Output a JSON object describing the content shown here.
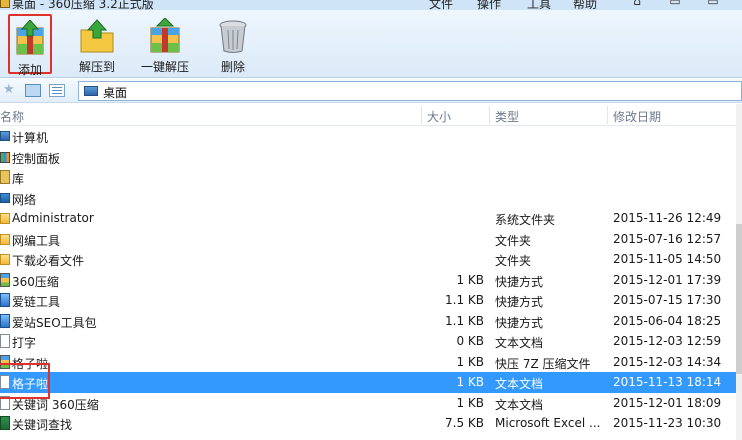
{
  "window": {
    "title": "桌面 - 360压缩 3.2正式版",
    "menus": [
      "文件",
      "操作",
      "工具",
      "帮助"
    ]
  },
  "toolbar": {
    "add_label": "添加",
    "extract_to_label": "解压到",
    "one_click_extract_label": "一键解压",
    "delete_label": "删除"
  },
  "address": {
    "path": "桌面"
  },
  "columns": {
    "name": "名称",
    "size": "大小",
    "type": "类型",
    "modified": "修改日期"
  },
  "files": [
    {
      "name": "计算机",
      "size": "",
      "type": "",
      "date": "",
      "icon": "computer-icon"
    },
    {
      "name": "控制面板",
      "size": "",
      "type": "",
      "date": "",
      "icon": "control-panel-icon"
    },
    {
      "name": "库",
      "size": "",
      "type": "",
      "date": "",
      "icon": "library-icon"
    },
    {
      "name": "网络",
      "size": "",
      "type": "",
      "date": "",
      "icon": "network-icon"
    },
    {
      "name": "Administrator",
      "size": "",
      "type": "系统文件夹",
      "date": "2015-11-26 12:49",
      "icon": "folder-icon"
    },
    {
      "name": "网编工具",
      "size": "",
      "type": "文件夹",
      "date": "2015-07-16 12:57",
      "icon": "folder-icon"
    },
    {
      "name": "下载必看文件",
      "size": "",
      "type": "文件夹",
      "date": "2015-11-05 14:50",
      "icon": "folder-icon"
    },
    {
      "name": "360压缩",
      "size": "1 KB",
      "type": "快捷方式",
      "date": "2015-12-01 17:39",
      "icon": "archive-icon"
    },
    {
      "name": "爱链工具",
      "size": "1.1 KB",
      "type": "快捷方式",
      "date": "2015-07-15 17:30",
      "icon": "app-icon"
    },
    {
      "name": "爱站SEO工具包",
      "size": "1.1 KB",
      "type": "快捷方式",
      "date": "2015-06-04 18:25",
      "icon": "app-icon"
    },
    {
      "name": "打字",
      "size": "0 KB",
      "type": "文本文档",
      "date": "2015-12-03 12:59",
      "icon": "text-file-icon"
    },
    {
      "name": "格子啦",
      "size": "1 KB",
      "type": "快压 7Z 压缩文件",
      "date": "2015-12-03 14:34",
      "icon": "archive-icon"
    },
    {
      "name": "格子啦",
      "size": "1 KB",
      "type": "文本文档",
      "date": "2015-11-13 18:14",
      "icon": "text-file-icon"
    },
    {
      "name": "关键词 360压缩",
      "size": "1 KB",
      "type": "文本文档",
      "date": "2015-12-01 18:09",
      "icon": "text-file-icon"
    },
    {
      "name": "关键词查找",
      "size": "7.5 KB",
      "type": "Microsoft Excel ...",
      "date": "2015-11-23 10:30",
      "icon": "spreadsheet-icon"
    }
  ],
  "selected_index": 12
}
